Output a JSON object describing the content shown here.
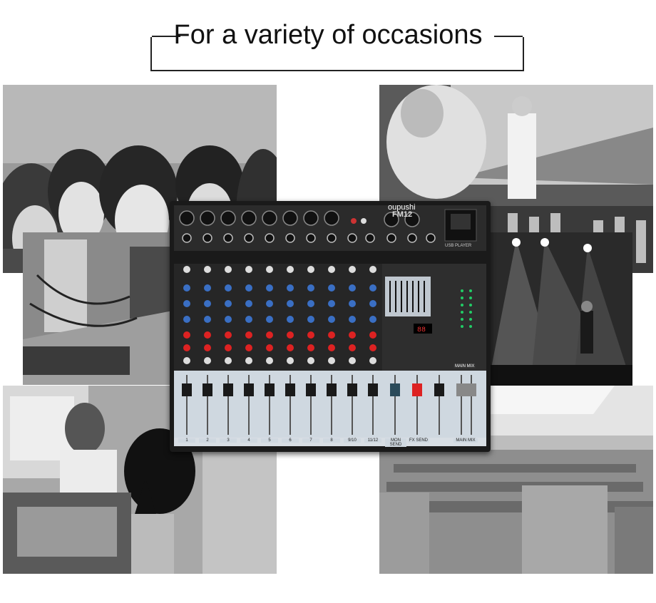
{
  "heading": {
    "title": "For a variety of occasions"
  },
  "mixer": {
    "brand": "oupushi",
    "model": "FM12",
    "usb_label": "USB PLAYER",
    "channel_labels": [
      "1",
      "2",
      "3",
      "4",
      "5",
      "6",
      "7",
      "8",
      "9/10",
      "11/12",
      "MON SEND",
      "FX SEND",
      "MAIN MIX"
    ],
    "main_mix_label": "MAIN MIX"
  },
  "photos": [
    {
      "name": "group-of-friends-photo"
    },
    {
      "name": "dj-stage-photo"
    },
    {
      "name": "computer-desk-photo"
    },
    {
      "name": "concert-lights-photo"
    },
    {
      "name": "radio-studio-photo"
    },
    {
      "name": "auditorium-photo"
    }
  ]
}
